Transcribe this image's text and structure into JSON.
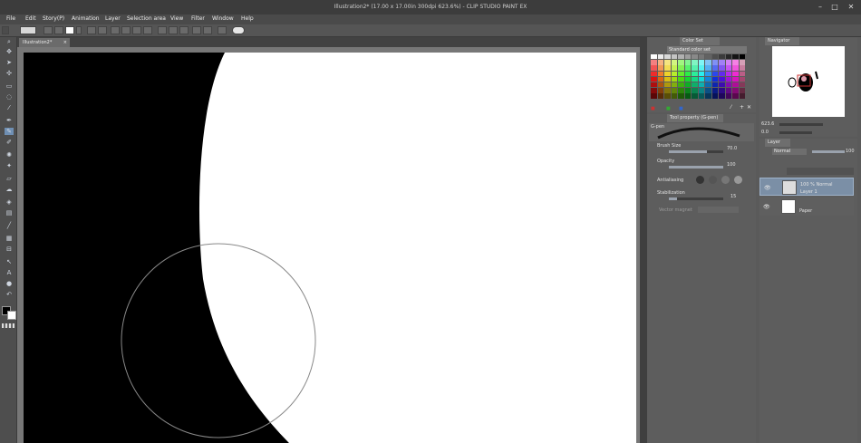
{
  "window": {
    "title": "Illustration2* (17.00 x 17.00in 300dpi 623.6%) - CLIP STUDIO PAINT EX"
  },
  "menu": {
    "items": [
      "File",
      "Edit",
      "Story(P)",
      "Animation",
      "Layer",
      "Selection area",
      "View",
      "Filter",
      "Window",
      "Help"
    ]
  },
  "document": {
    "tab_label": "Illustration2*"
  },
  "color_set": {
    "tab_label": "Color Set",
    "set_name": "Standard color set"
  },
  "tool_property": {
    "tab_label": "Tool property (G-pen)",
    "tool_name": "G-pen",
    "brush_size": {
      "label": "Brush Size",
      "value": "70.0",
      "fraction": 0.7
    },
    "opacity": {
      "label": "Opacity",
      "value": "100",
      "fraction": 1.0
    },
    "antialiasing": {
      "label": "Antialiasing"
    },
    "stabilization": {
      "label": "Stabilization",
      "value": "15",
      "fraction": 0.15
    },
    "vector_magnet": {
      "label": "Vector magnet"
    }
  },
  "navigator": {
    "tab_label": "Navigator",
    "zoom": "623.6",
    "angle": "0.0"
  },
  "layer": {
    "tab_label": "Layer",
    "blend_mode": "Normal",
    "opacity_value": "100",
    "layers": [
      {
        "line1": "100 % Normal",
        "line2": "Layer 1",
        "selected": true
      },
      {
        "line1": "",
        "line2": "Paper",
        "selected": false
      }
    ]
  },
  "colors": {
    "main_color": "#000000",
    "sub_color": "#ffffff",
    "accent": "#6f8fb3"
  }
}
